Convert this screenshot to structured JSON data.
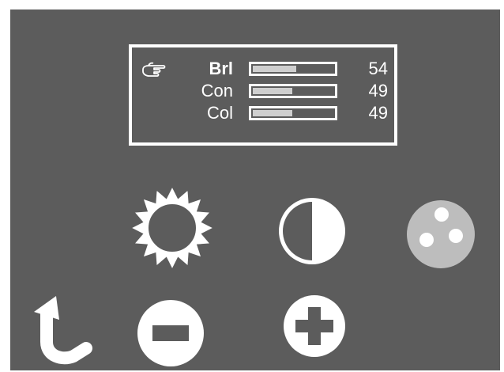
{
  "menu": {
    "items": [
      {
        "label": "Brl",
        "value": "54",
        "level": 54,
        "selected": true
      },
      {
        "label": "Con",
        "value": "49",
        "level": 49,
        "selected": false
      },
      {
        "label": "Col",
        "value": "49",
        "level": 49,
        "selected": false
      }
    ]
  },
  "icons": {
    "brightness": "sun-icon",
    "contrast": "contrast-icon",
    "color": "color-palette-icon",
    "back": "back-arrow-icon",
    "decrease": "minus-icon",
    "increase": "plus-icon"
  },
  "colors": {
    "background": "#5c5c5c",
    "foreground": "#ffffff",
    "bar_fill": "#cfcfcf",
    "disabled_icon": "#bdbdbd"
  }
}
